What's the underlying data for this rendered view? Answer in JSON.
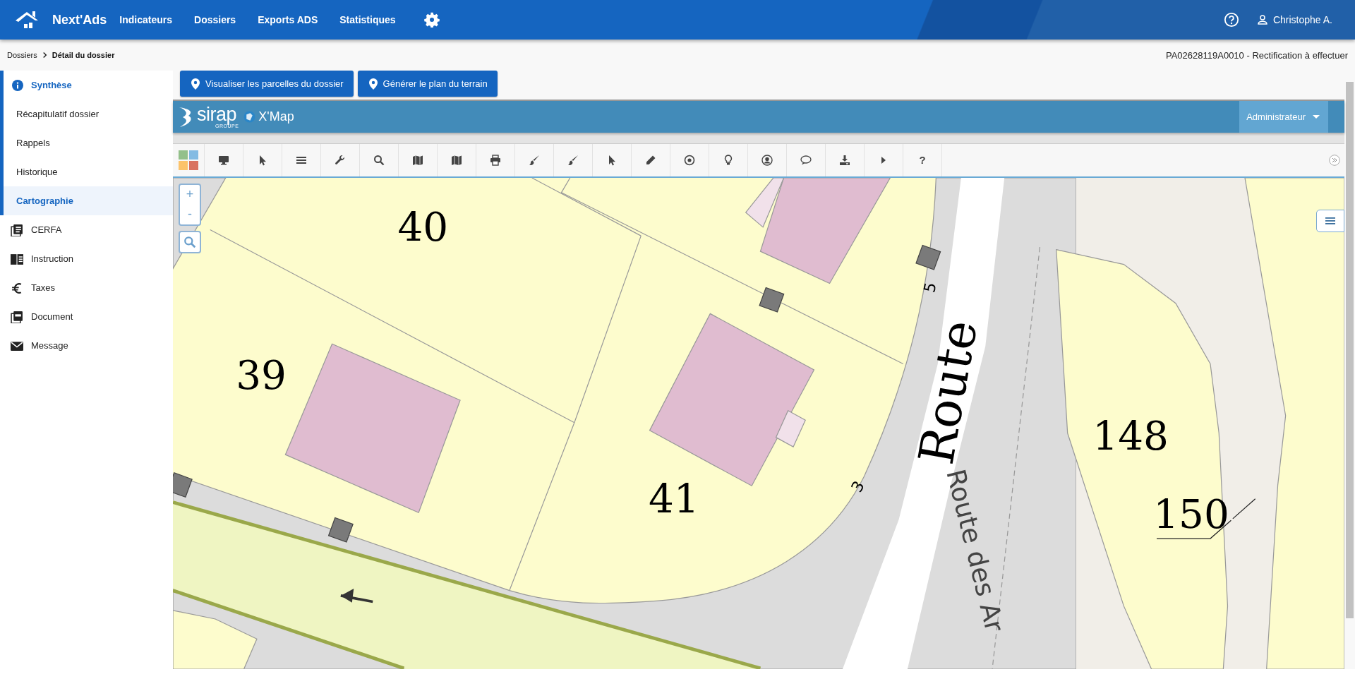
{
  "app": {
    "name": "Next'Ads",
    "nav": [
      {
        "label": "Indicateurs"
      },
      {
        "label": "Dossiers"
      },
      {
        "label": "Exports ADS"
      },
      {
        "label": "Statistiques"
      }
    ],
    "user": "Christophe A."
  },
  "breadcrumb": [
    {
      "label": "Dossiers",
      "current": false
    },
    {
      "label": "Détail du dossier",
      "current": true
    }
  ],
  "dossier_title": "PA02628119A0010 - Rectification à effectuer",
  "sidebar": {
    "items": [
      {
        "label": "Synthèse",
        "kind": "section",
        "selected": false
      },
      {
        "label": "Récapitulatif dossier",
        "kind": "sub",
        "selected": false
      },
      {
        "label": "Rappels",
        "kind": "sub",
        "selected": false
      },
      {
        "label": "Historique",
        "kind": "sub",
        "selected": false
      },
      {
        "label": "Cartographie",
        "kind": "sub",
        "selected": true
      },
      {
        "label": "CERFA",
        "kind": "link",
        "selected": false
      },
      {
        "label": "Instruction",
        "kind": "link",
        "selected": false
      },
      {
        "label": "Taxes",
        "kind": "link",
        "selected": false
      },
      {
        "label": "Document",
        "kind": "link",
        "selected": false
      },
      {
        "label": "Message",
        "kind": "link",
        "selected": false
      }
    ]
  },
  "actions": [
    {
      "label": "Visualiser les parcelles du dossier"
    },
    {
      "label": "Générer le plan du terrain"
    }
  ],
  "xmap": {
    "brand": "sirap",
    "brand_sub": "GROUPE",
    "product": "X'Map",
    "profile": "Administrateur",
    "tools": [
      {
        "kind": "palette"
      },
      {
        "kind": "monitor"
      },
      {
        "kind": "pointer"
      },
      {
        "kind": "list"
      },
      {
        "kind": "wrench"
      },
      {
        "kind": "search"
      },
      {
        "kind": "map"
      },
      {
        "kind": "map"
      },
      {
        "kind": "printer"
      },
      {
        "kind": "brush"
      },
      {
        "kind": "brush"
      },
      {
        "kind": "pointer"
      },
      {
        "kind": "pencil"
      },
      {
        "kind": "target"
      },
      {
        "kind": "bulb"
      },
      {
        "kind": "user"
      },
      {
        "kind": "comment"
      },
      {
        "kind": "download"
      },
      {
        "kind": "play"
      },
      {
        "kind": "help",
        "glyph": "?"
      }
    ]
  },
  "map": {
    "zoom_in": "+",
    "zoom_out": "-",
    "labels": [
      {
        "text": "40",
        "kind": "parcel"
      },
      {
        "text": "39",
        "kind": "parcel"
      },
      {
        "text": "41",
        "kind": "parcel"
      },
      {
        "text": "148",
        "kind": "parcel"
      },
      {
        "text": "150",
        "kind": "parcel"
      },
      {
        "text": "5",
        "kind": "house"
      },
      {
        "text": "3",
        "kind": "house"
      },
      {
        "text": "Route",
        "kind": "street"
      },
      {
        "text": "Route des Ar",
        "kind": "tile"
      }
    ]
  }
}
